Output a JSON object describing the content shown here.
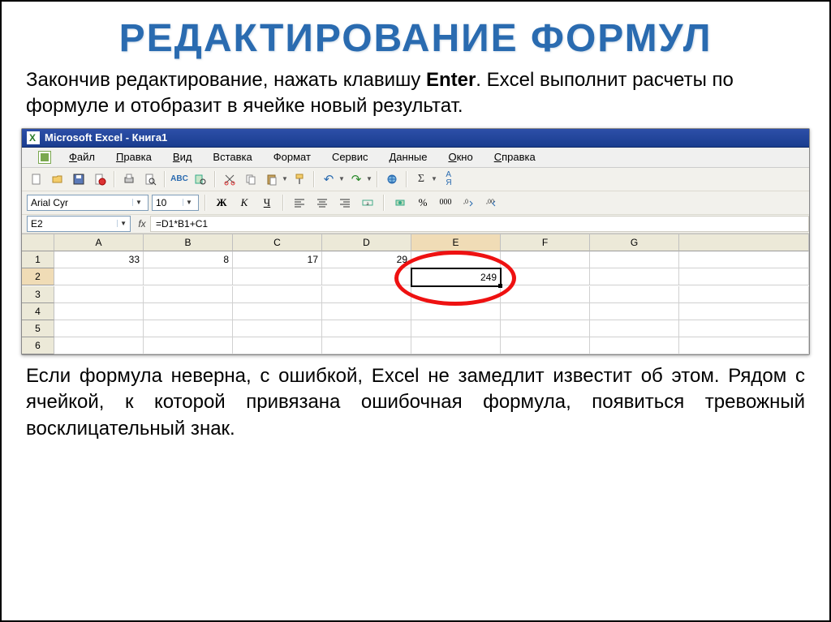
{
  "title": "РЕДАКТИРОВАНИЕ ФОРМУЛ",
  "intro_text_pre": "Закончив редактирование, нажать клавишу ",
  "intro_text_bold": "Enter",
  "intro_text_post": ". Excel выполнит расчеты по формуле и отобразит в ячейке новый результат.",
  "outro_text": "Если формула неверна, с ошибкой, Excel не замедлит  известит об этом. Рядом с ячейкой, к которой привязана ошибочная формула, появиться тревожный восклицательный знак.",
  "app_title": "Microsoft Excel - Книга1",
  "menu": [
    "Файл",
    "Правка",
    "Вид",
    "Вставка",
    "Формат",
    "Сервис",
    "Данные",
    "Окно",
    "Справка"
  ],
  "font_name": "Arial Cyr",
  "font_size": "10",
  "format_buttons": {
    "bold": "Ж",
    "italic": "К",
    "underline": "Ч"
  },
  "number_buttons": {
    "percent": "%",
    "thousands": "000"
  },
  "namebox_value": "E2",
  "fx_label": "fx",
  "formula_value": "=D1*B1+C1",
  "columns": [
    "A",
    "B",
    "C",
    "D",
    "E",
    "F",
    "G"
  ],
  "rows": [
    "1",
    "2",
    "3",
    "4",
    "5",
    "6"
  ],
  "selected_cell": {
    "row": 1,
    "col": 4
  },
  "grid": [
    [
      "33",
      "8",
      "17",
      "29",
      "",
      "",
      ""
    ],
    [
      "",
      "",
      "",
      "",
      "249",
      "",
      ""
    ],
    [
      "",
      "",
      "",
      "",
      "",
      "",
      ""
    ],
    [
      "",
      "",
      "",
      "",
      "",
      "",
      ""
    ],
    [
      "",
      "",
      "",
      "",
      "",
      "",
      ""
    ],
    [
      "",
      "",
      "",
      "",
      "",
      "",
      ""
    ]
  ]
}
